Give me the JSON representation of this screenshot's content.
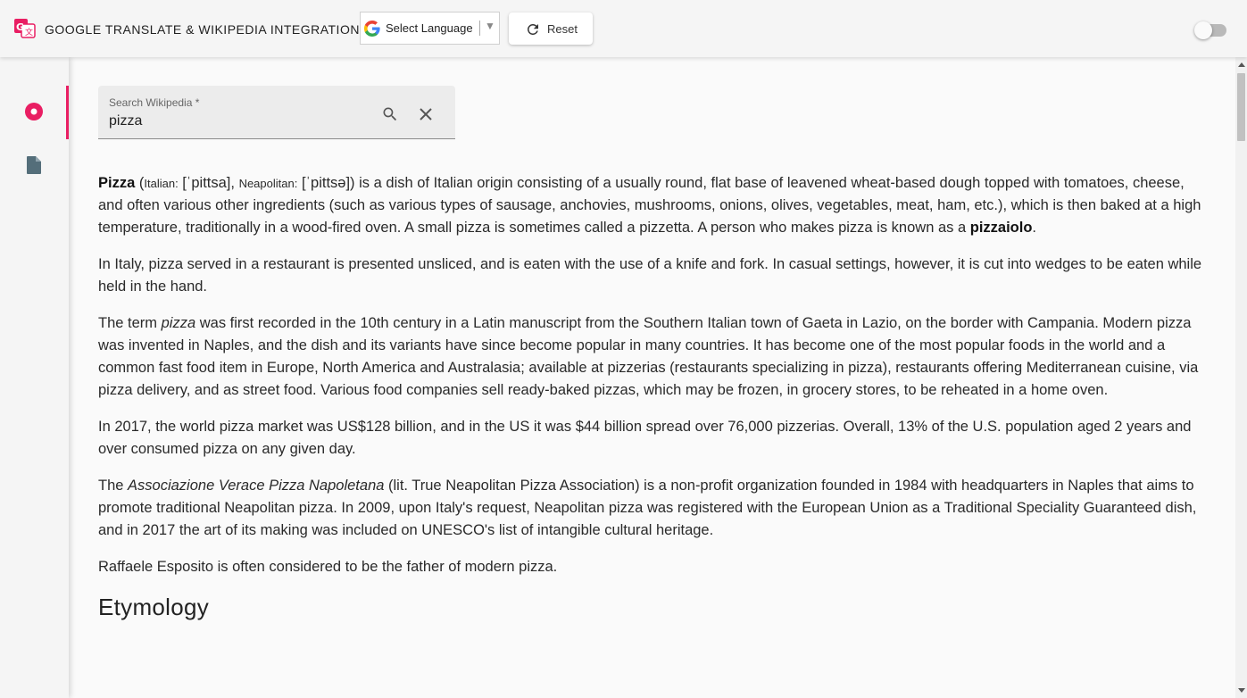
{
  "header": {
    "title": "GOOGLE TRANSLATE & WIKIPEDIA INTEGRATION",
    "language_select": {
      "label": "Select Language",
      "arrow": "▼"
    },
    "reset_label": "Reset"
  },
  "sidebar": {
    "items": [
      {
        "icon": "record-icon",
        "active": true
      },
      {
        "icon": "document-icon",
        "active": false
      }
    ]
  },
  "search": {
    "label": "Search Wikipedia *",
    "value": "pizza"
  },
  "article": {
    "p1": {
      "title": "Pizza",
      "open": "(",
      "italian_label": "Italian:",
      "italian_ipa": "[ˈpittsa],",
      "neapolitan_label": "Neapolitan:",
      "neapolitan_ipa": "[ˈpittsə])",
      "text": "is a dish of Italian origin consisting of a usually round, flat base of leavened wheat-based dough topped with tomatoes, cheese, and often various other ingredients (such as various types of sausage, anchovies, mushrooms, onions, olives, vegetables, meat, ham, etc.), which is then baked at a high temperature, traditionally in a wood-fired oven. A small pizza is sometimes called a pizzetta. A person who makes pizza is known as a",
      "term": "pizzaiolo",
      "end": "."
    },
    "p2": "In Italy, pizza served in a restaurant is presented unsliced, and is eaten with the use of a knife and fork. In casual settings, however, it is cut into wedges to be eaten while held in the hand.",
    "p3": {
      "before": "The term",
      "term": "pizza",
      "after": "was first recorded in the 10th century in a Latin manuscript from the Southern Italian town of Gaeta in Lazio, on the border with Campania. Modern pizza was invented in Naples, and the dish and its variants have since become popular in many countries. It has become one of the most popular foods in the world and a common fast food item in Europe, North America and Australasia; available at pizzerias (restaurants specializing in pizza), restaurants offering Mediterranean cuisine, via pizza delivery, and as street food. Various food companies sell ready-baked pizzas, which may be frozen, in grocery stores, to be reheated in a home oven."
    },
    "p4": "In 2017, the world pizza market was US$128 billion, and in the US it was $44 billion spread over 76,000 pizzerias. Overall, 13% of the U.S. population aged 2 years and over consumed pizza on any given day.",
    "p5": {
      "before": "The",
      "name": "Associazione Verace Pizza Napoletana",
      "after": "(lit. True Neapolitan Pizza Association) is a non-profit organization founded in 1984 with headquarters in Naples that aims to promote traditional Neapolitan pizza. In 2009, upon Italy's request, Neapolitan pizza was registered with the European Union as a Traditional Speciality Guaranteed dish, and in 2017 the art of its making was included on UNESCO's list of intangible cultural heritage."
    },
    "p6": "Raffaele Esposito is often considered to be the father of modern pizza.",
    "heading": "Etymology"
  },
  "colors": {
    "accent": "#e91e63",
    "toolbar": "#f5f5f5",
    "icon_grey": "#546e7a"
  }
}
